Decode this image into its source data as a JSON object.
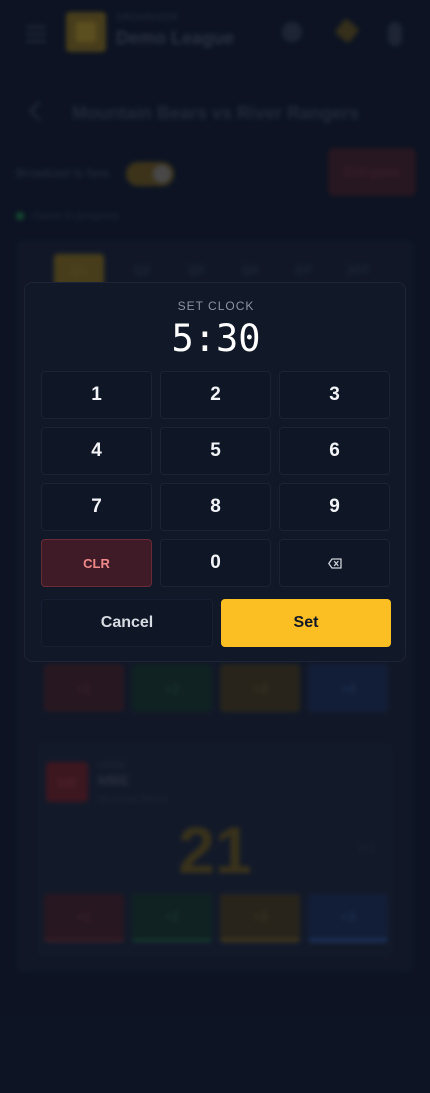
{
  "header": {
    "league_kicker": "ORGANIZER",
    "league_name": "Demo League",
    "logo_text": ""
  },
  "match": {
    "title": "Mountain Bears vs River Rangers",
    "broadcast_label": "Broadcast to fans",
    "end_game_label": "End game",
    "live_label": "Game in progress",
    "periods": [
      "Q1",
      "Q2",
      "Q3",
      "Q4",
      "OT",
      "2OT"
    ]
  },
  "team": {
    "badge": "MB",
    "kicker": "HOME",
    "abbr": "MBE",
    "name": "Mountain Bears",
    "score": "21",
    "fouls": "F 2"
  },
  "score_buttons": [
    "+1",
    "+2",
    "+3",
    "+4"
  ],
  "modal": {
    "label": "SET CLOCK",
    "clock": "5:30",
    "keys": [
      "1",
      "2",
      "3",
      "4",
      "5",
      "6",
      "7",
      "8",
      "9",
      "CLR",
      "0"
    ],
    "cancel_label": "Cancel",
    "set_label": "Set"
  },
  "colors": {
    "accent": "#fbbf24",
    "danger": "#f08a8a",
    "background": "#111a2b"
  }
}
